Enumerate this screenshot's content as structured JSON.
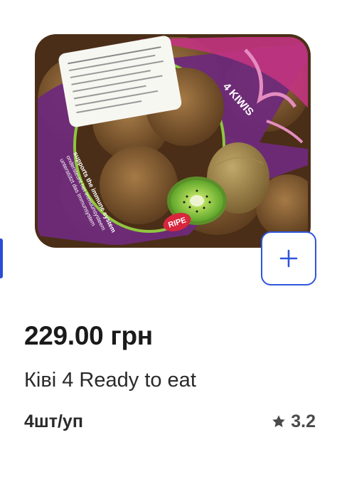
{
  "product": {
    "price": "229.00 грн",
    "title": "Ківі 4 Ready to eat",
    "unit": "4шт/уп",
    "rating": "3.2"
  },
  "packaging": {
    "band_text": "4 KIWIS",
    "side_text_1": "supports the immune system",
    "side_text_2": "ondersteunt het immuunsysteem",
    "side_text_3": "unterstützt das Immunsystem",
    "badge_text": "RIPE"
  },
  "icons": {
    "add": "plus-icon",
    "rating": "star-icon"
  },
  "colors": {
    "accent": "#2f56d9",
    "package_purple": "#6e2a7a",
    "package_magenta": "#c2347f",
    "kiwi_green": "#7cc242"
  }
}
